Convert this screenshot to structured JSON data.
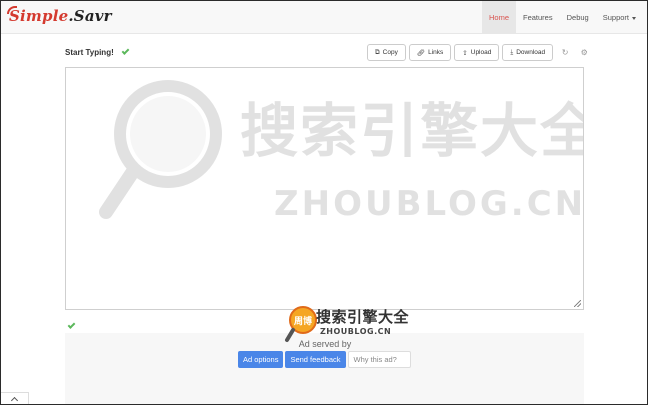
{
  "brand": {
    "part1": "Simple",
    "dot": ".",
    "part2": "Savr"
  },
  "nav": {
    "items": [
      {
        "label": "Home"
      },
      {
        "label": "Features"
      },
      {
        "label": "Debug"
      },
      {
        "label": "Support"
      }
    ]
  },
  "editor": {
    "title": "Start Typing!",
    "value": ""
  },
  "toolbar": {
    "copy": "Copy",
    "links": "Links",
    "upload": "Upload",
    "download": "Download"
  },
  "watermark": {
    "cn": "搜索引擎大全",
    "en": "ZHOUBLOG.CN",
    "logo_text": "周博"
  },
  "ad": {
    "served_by": "Ad served by",
    "options": "Ad options",
    "feedback": "Send feedback",
    "why": "Why this ad?"
  },
  "colors": {
    "brand_red": "#d43a2f",
    "success_green": "#5cb85c",
    "ad_blue": "#4a86e8",
    "active_nav": "#d9534f"
  },
  "icons": [
    "copy-icon",
    "link-icon",
    "upload-icon",
    "download-icon",
    "refresh-icon",
    "gear-icon",
    "check-icon",
    "chevron-up-icon"
  ]
}
